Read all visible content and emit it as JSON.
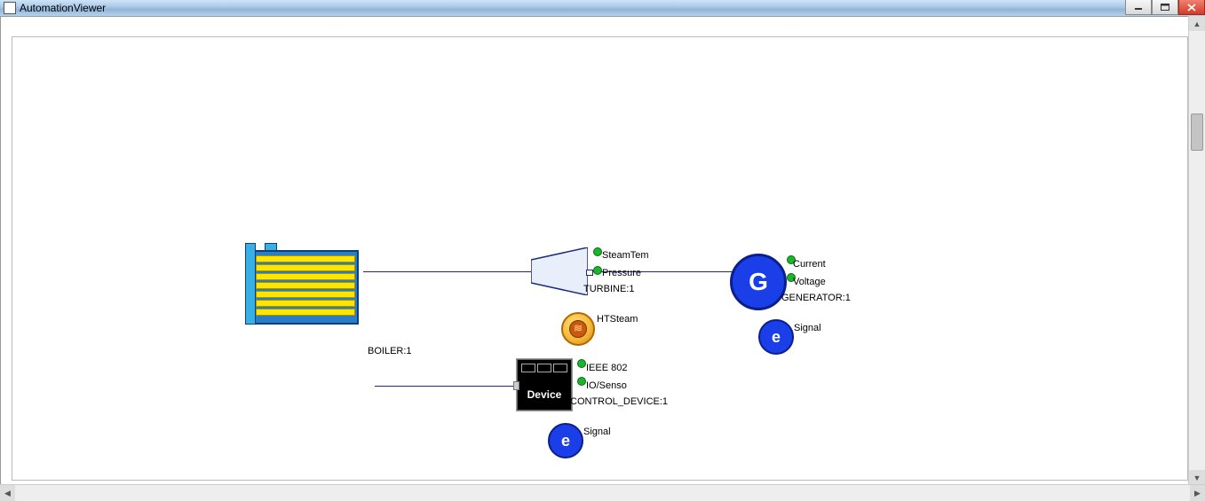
{
  "window": {
    "title": "AutomationViewer"
  },
  "nodes": {
    "boiler": {
      "label": "BOILER:1"
    },
    "turbine": {
      "label": "TURBINE:1",
      "ports": {
        "p1": "SteamTem",
        "p2": "Pressure"
      }
    },
    "generator": {
      "label": "GENERATOR:1",
      "letter": "G",
      "ports": {
        "p1": "Current",
        "p2": "Voltage"
      }
    },
    "gen_signal": {
      "letter": "e",
      "label": "Signal"
    },
    "htsteam": {
      "label": "HTSteam"
    },
    "device": {
      "label": "CONTROL_DEVICE:1",
      "inner": "Device",
      "ports": {
        "p1": "IEEE 802",
        "p2": "IO/Senso"
      }
    },
    "dev_signal": {
      "letter": "e",
      "label": "Signal"
    }
  }
}
